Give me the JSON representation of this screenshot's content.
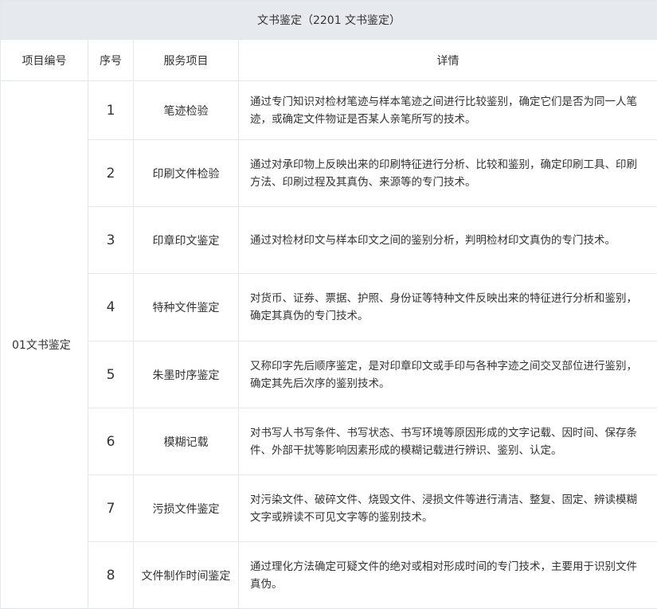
{
  "title": "文书鉴定（2201 文书鉴定）",
  "headers": {
    "project_code": "项目编号",
    "seq": "序号",
    "service": "服务项目",
    "detail": "详情"
  },
  "project_code_value": "01文书鉴定",
  "rows": [
    {
      "seq": "1",
      "service": "笔迹检验",
      "detail": "通过专门知识对检材笔迹与样本笔迹之间进行比较鉴别，确定它们是否为同一人笔迹，或确定文件物证是否某人亲笔所写的技术。"
    },
    {
      "seq": "2",
      "service": "印刷文件检验",
      "detail": "通过对承印物上反映出来的印刷特征进行分析、比较和鉴别，确定印刷工具、印刷方法、印刷过程及其真伪、来源等的专门技术。"
    },
    {
      "seq": "3",
      "service": "印章印文鉴定",
      "detail": "通过对检材印文与样本印文之间的鉴别分析，判明检材印文真伪的专门技术。"
    },
    {
      "seq": "4",
      "service": "特种文件鉴定",
      "detail": "对货币、证券、票据、护照、身份证等特种文件反映出来的特征进行分析和鉴别，确定其真伪的专门技术。"
    },
    {
      "seq": "5",
      "service": "朱墨时序鉴定",
      "detail": "又称印字先后顺序鉴定，是对印章印文或手印与各种字迹之间交叉部位进行鉴别，确定其先后次序的鉴别技术。"
    },
    {
      "seq": "6",
      "service": "模糊记载",
      "detail": "对书写人书写条件、书写状态、书写环境等原因形成的文字记载、因时间、保存条件、外部干扰等影响因素形成的模糊记载进行辨识、鉴别、认定。"
    },
    {
      "seq": "7",
      "service": "污损文件鉴定",
      "detail": "对污染文件、破碎文件、烧毁文件、浸损文件等进行清洁、整复、固定、辨读模糊文字或辨读不可见文字等的鉴别技术。"
    },
    {
      "seq": "8",
      "service": "文件制作时间鉴定",
      "detail": "通过理化方法确定可疑文件的绝对或相对形成时间的专门技术，主要用于识别文件真伪。"
    }
  ]
}
